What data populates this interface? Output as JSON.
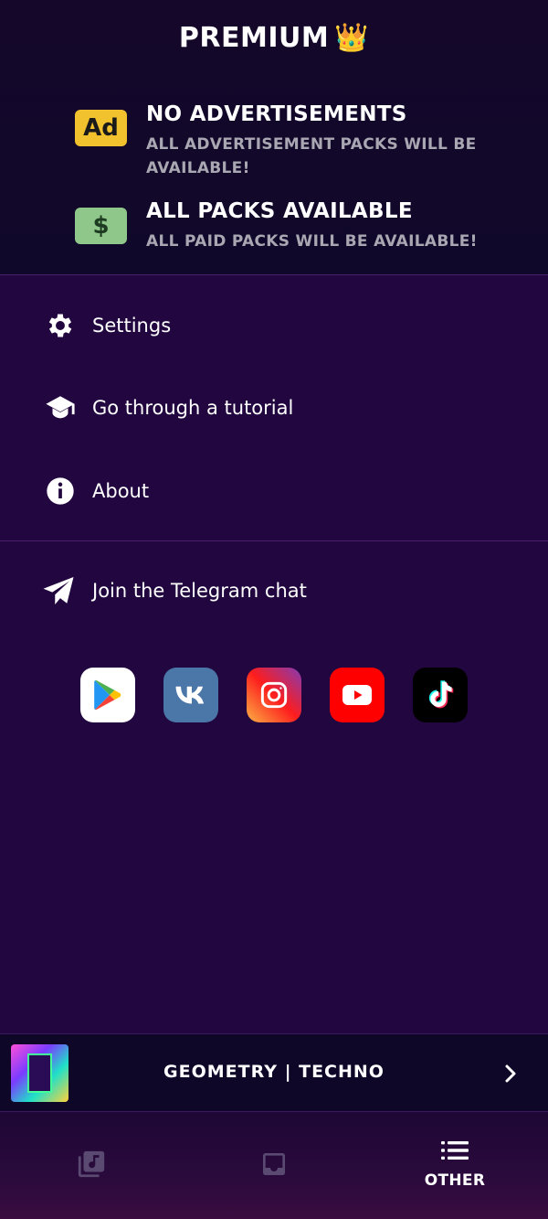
{
  "premium": {
    "title": "PREMIUM",
    "crown": "👑",
    "features": [
      {
        "icon": "ad-icon",
        "icon_text": "Ad",
        "title": "NO ADVERTISEMENTS",
        "description": "ALL ADVERTISEMENT PACKS WILL BE AVAILABLE!"
      },
      {
        "icon": "dollar-icon",
        "icon_text": "$",
        "title": "ALL PACKS AVAILABLE",
        "description": "ALL PAID PACKS WILL BE AVAILABLE!"
      }
    ]
  },
  "menu": {
    "settings": "Settings",
    "tutorial": "Go through a tutorial",
    "about": "About",
    "telegram": "Join the Telegram chat"
  },
  "socials": [
    "google-play-icon",
    "vk-icon",
    "instagram-icon",
    "youtube-icon",
    "tiktok-icon"
  ],
  "now_playing": {
    "title": "GEOMETRY | TECHNO"
  },
  "nav": {
    "tabs": [
      {
        "icon": "music-library-icon",
        "label": ""
      },
      {
        "icon": "inbox-icon",
        "label": ""
      },
      {
        "icon": "list-icon",
        "label": "OTHER",
        "active": true
      }
    ]
  },
  "colors": {
    "background": "#22063f",
    "premium_bg": "#10082a",
    "accent_gold": "#f2c12e",
    "accent_green": "#8fc78a",
    "muted_text": "#a9a7b2"
  }
}
